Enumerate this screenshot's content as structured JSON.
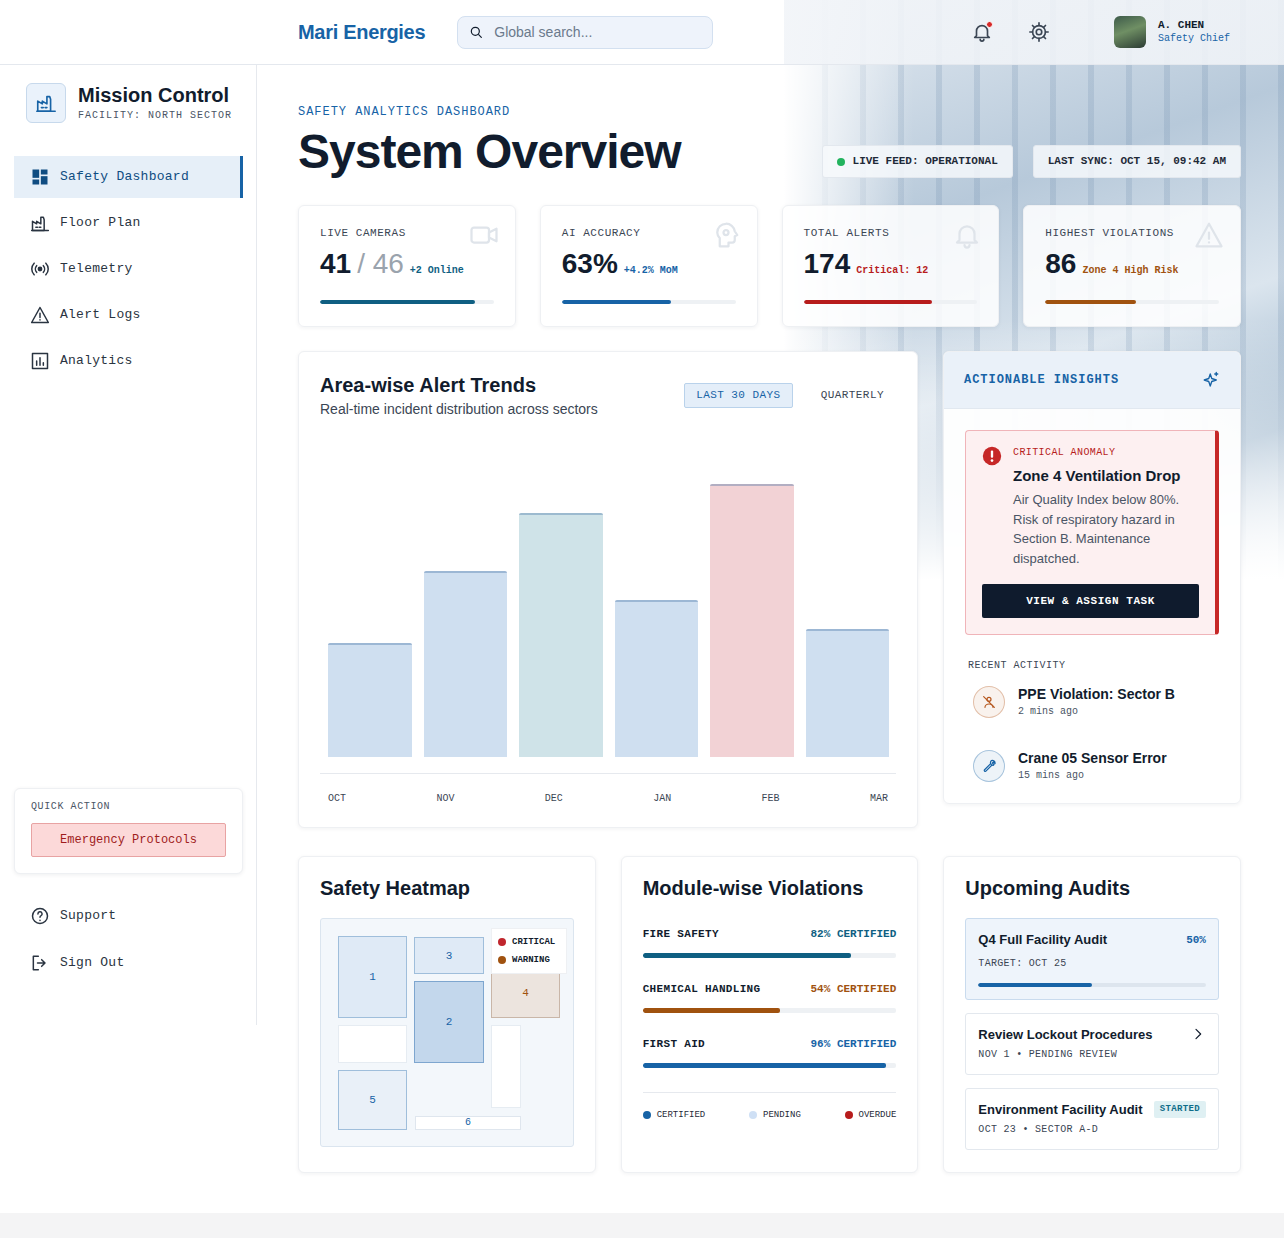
{
  "header": {
    "brand": "Mari Energies",
    "search": {
      "placeholder": "Global search..."
    },
    "notifications": {
      "unread": true
    },
    "user": {
      "name": "A. CHEN",
      "role": "Safety Chief"
    }
  },
  "sidebar": {
    "title": "Mission Control",
    "subtitle": "FACILITY: NORTH SECTOR",
    "items": [
      {
        "label": "Safety Dashboard",
        "selected": true
      },
      {
        "label": "Floor Plan",
        "selected": false
      },
      {
        "label": "Telemetry",
        "selected": false
      },
      {
        "label": "Alert Logs",
        "selected": false
      },
      {
        "label": "Analytics",
        "selected": false
      }
    ],
    "quick_action": {
      "label": "QUICK ACTION",
      "button": "Emergency Protocols"
    },
    "footer_items": [
      {
        "label": "Support"
      },
      {
        "label": "Sign Out"
      }
    ]
  },
  "page": {
    "eyebrow": "SAFETY ANALYTICS DASHBOARD",
    "title": "System Overview",
    "status": [
      {
        "label": "LIVE FEED: OPERATIONAL",
        "live": true
      },
      {
        "label": "LAST SYNC: OCT 15, 09:42 AM",
        "live": false
      }
    ]
  },
  "kpis": [
    {
      "label": "LIVE CAMERAS",
      "value": "41",
      "total": "/ 46",
      "note": "+2 Online",
      "level": 0.89,
      "color": "#0f5f82"
    },
    {
      "label": "AI ACCURACY",
      "value": "63%",
      "note": "+4.2% MoM",
      "level": 0.63,
      "color": "#1763a6"
    },
    {
      "label": "TOTAL ALERTS",
      "value": "174",
      "note": "Critical: 12",
      "level": 0.74,
      "color": "#b71c1c"
    },
    {
      "label": "HIGHEST VIOLATIONS",
      "value": "86",
      "note": "Zone 4 High Risk",
      "level": 0.52,
      "color": "#a0520f"
    }
  ],
  "chart": {
    "title": "Area-wise Alert Trends",
    "subtitle": "Real-time incident distribution across sectors",
    "ranges": [
      {
        "label": "LAST 30 DAYS",
        "selected": true
      },
      {
        "label": "QUARTERLY",
        "selected": false
      }
    ],
    "x_labels": [
      "OCT",
      "NOV",
      "DEC",
      "JAN",
      "FEB",
      "MAR"
    ],
    "series": [
      {
        "values": [
          114,
          186,
          244,
          157,
          273,
          128
        ],
        "colors": [
          "#cfdff0",
          "#cfdff0",
          "#cfe3e8",
          "#cfdff0",
          "#f2d2d5",
          "#cfdff0"
        ]
      }
    ]
  },
  "insights": {
    "title": "ACTIONABLE INSIGHTS",
    "alert": {
      "tag": "CRITICAL ANOMALY",
      "title": "Zone 4 Ventilation Drop",
      "body": "Air Quality Index below 80%. Risk of respiratory hazard in Section B. Maintenance dispatched.",
      "button": "VIEW & ASSIGN TASK"
    },
    "recent_title": "RECENT ACTIVITY",
    "recent": [
      {
        "title": "PPE Violation: Sector B",
        "time": "2 mins ago",
        "color": "#b5561c"
      },
      {
        "title": "Crane 05 Sensor Error",
        "time": "15 mins ago",
        "color": "#1763a6"
      }
    ]
  },
  "heatmap": {
    "title": "Safety Heatmap",
    "legend": [
      {
        "label": "CRITICAL",
        "color": "#c0262d"
      },
      {
        "label": "WARNING",
        "color": "#a0520f"
      }
    ],
    "zones": [
      {
        "label": "1",
        "status": "normal",
        "color": "#dfeaf6"
      },
      {
        "label": "3",
        "status": "normal",
        "color": "#dfeaf6"
      },
      {
        "label": "2",
        "status": "elevated",
        "color": "#c3d7ec"
      },
      {
        "label": "4",
        "status": "warning",
        "color": "#ece4de"
      },
      {
        "label": "5",
        "status": "normal",
        "color": "#e9f0f8"
      },
      {
        "label": "6",
        "status": "minor",
        "color": "#ffffff"
      }
    ]
  },
  "modules": {
    "title": "Module-wise Violations",
    "items": [
      {
        "name": "FIRE SAFETY",
        "reading": "82% CERTIFIED",
        "level": 0.82,
        "color": "#0f5f82"
      },
      {
        "name": "CHEMICAL HANDLING",
        "reading": "54% CERTIFIED",
        "level": 0.54,
        "color": "#a0520f"
      },
      {
        "name": "FIRST AID",
        "reading": "96% CERTIFIED",
        "level": 0.96,
        "color": "#1763a6"
      }
    ],
    "legend": [
      {
        "label": "CERTIFIED",
        "color": "#1763a6"
      },
      {
        "label": "PENDING",
        "color": "#cfe0f5"
      },
      {
        "label": "OVERDUE",
        "color": "#b71c1c"
      }
    ]
  },
  "audits": {
    "title": "Upcoming Audits",
    "items": [
      {
        "kind": "progress",
        "title": "Q4 Full Facility Audit",
        "meta": "TARGET: OCT 25",
        "reading": "50%",
        "level": 0.5
      },
      {
        "kind": "link",
        "title": "Review Lockout Procedures",
        "meta": "NOV 1 • PENDING REVIEW"
      },
      {
        "kind": "badge",
        "title": "Environment Facility Audit",
        "meta": "OCT 23 • SECTOR A-D",
        "badge": "STARTED"
      }
    ]
  }
}
